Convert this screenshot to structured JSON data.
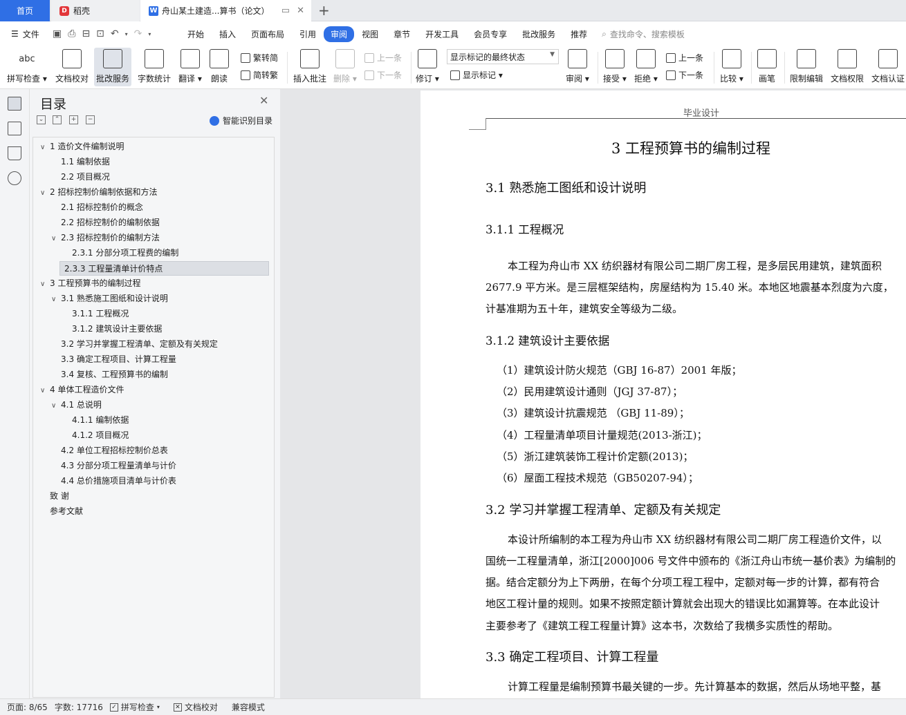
{
  "tabs": {
    "home": "首页",
    "daoke": "稻壳",
    "daoke_logo": "D",
    "doc": "舟山某土建造...算书（论文）",
    "doc_logo": "W"
  },
  "menubar": {
    "file": "文件",
    "items": [
      "开始",
      "插入",
      "页面布局",
      "引用",
      "审阅",
      "视图",
      "章节",
      "开发工具",
      "会员专享",
      "批改服务",
      "推荐"
    ],
    "active": "审阅",
    "search_placeholder": "查找命令、搜索模板"
  },
  "ribbon": {
    "spellcheck": "拼写检查",
    "spellcheck_icon": "abc",
    "doc_proof": "文档校对",
    "review_service": "批改服务",
    "word_count": "字数统计",
    "translate": "翻译",
    "read_aloud": "朗读",
    "trad_to_simp": "繁转简",
    "simp_to_trad": "简转繁",
    "insert_comment": "插入批注",
    "delete": "删除",
    "prev_comment": "上一条",
    "next_comment": "下一条",
    "track_changes": "修订",
    "markup_select": "显示标记的最终状态",
    "show_markup": "显示标记",
    "review": "审阅",
    "accept": "接受",
    "reject": "拒绝",
    "prev_change": "上一条",
    "next_change": "下一条",
    "compare": "比较",
    "pen": "画笔",
    "restrict_edit": "限制编辑",
    "doc_permission": "文档权限",
    "doc_certify": "文档认证"
  },
  "outline": {
    "title": "目录",
    "smart_toc": "智能识别目录",
    "items": [
      {
        "text": "1 造价文件编制说明",
        "level": 1,
        "twisty": "v"
      },
      {
        "text": "1.1 编制依据",
        "level": 2,
        "twisty": ""
      },
      {
        "text": "2.2  项目概况",
        "level": 2,
        "twisty": ""
      },
      {
        "text": "2 招标控制价编制依据和方法",
        "level": 1,
        "twisty": "v"
      },
      {
        "text": "2.1 招标控制价的概念",
        "level": 2,
        "twisty": ""
      },
      {
        "text": "2.2 招标控制价的编制依据",
        "level": 2,
        "twisty": ""
      },
      {
        "text": "2.3 招标控制价的编制方法",
        "level": 2,
        "twisty": "v"
      },
      {
        "text": "2.3.1 分部分项工程费的编制",
        "level": 3,
        "twisty": ""
      },
      {
        "text": "2.3.3 工程量清单计价特点",
        "level": 3,
        "twisty": "",
        "selected": true
      },
      {
        "text": "3 工程预算书的编制过程",
        "level": 1,
        "twisty": "v"
      },
      {
        "text": "3.1 熟悉施工图纸和设计说明",
        "level": 2,
        "twisty": "v"
      },
      {
        "text": "3.1.1 工程概况",
        "level": 3,
        "twisty": ""
      },
      {
        "text": "3.1.2 建筑设计主要依据",
        "level": 3,
        "twisty": ""
      },
      {
        "text": "3.2 学习并掌握工程清单、定额及有关规定",
        "level": 2,
        "twisty": ""
      },
      {
        "text": "3.3 确定工程项目、计算工程量",
        "level": 2,
        "twisty": ""
      },
      {
        "text": "3.4 复核、工程预算书的编制",
        "level": 2,
        "twisty": ""
      },
      {
        "text": "4 单体工程造价文件",
        "level": 1,
        "twisty": "v"
      },
      {
        "text": "4.1 总说明",
        "level": 2,
        "twisty": "v"
      },
      {
        "text": "4.1.1 编制依据",
        "level": 3,
        "twisty": ""
      },
      {
        "text": "4.1.2 项目概况",
        "level": 3,
        "twisty": ""
      },
      {
        "text": "4.2 单位工程招标控制价总表",
        "level": 2,
        "twisty": ""
      },
      {
        "text": "4.3 分部分项工程量清单与计价",
        "level": 2,
        "twisty": ""
      },
      {
        "text": "4.4 总价措施项目清单与计价表",
        "level": 2,
        "twisty": ""
      },
      {
        "text": "致    谢",
        "level": 1,
        "twisty": ""
      },
      {
        "text": "参考文献",
        "level": 1,
        "twisty": ""
      }
    ]
  },
  "document": {
    "header": "毕业设计",
    "chapter_title": "3 工程预算书的编制过程",
    "s31": "3.1 熟悉施工图纸和设计说明",
    "s311": "3.1.1 工程概况",
    "p1_l1": "本工程为舟山市 XX 纺织器材有限公司二期厂房工程，是多层民用建筑，建筑面积",
    "p1_l2": "2677.9 平方米。是三层框架结构，房屋结构为 15.40 米。本地区地震基本烈度为六度，",
    "p1_l3": "计基准期为五十年，建筑安全等级为二级。",
    "s312": "3.1.2 建筑设计主要依据",
    "basis": [
      "（1）建筑设计防火规范（GBJ 16-87）2001 年版；",
      "（2）民用建筑设计通则（JGJ    37-87）；",
      "（3）建筑设计抗震规范 （GBJ    11-89）；",
      "（4）工程量清单项目计量规范(2013-浙江)；",
      "（5）浙江建筑装饰工程计价定额(2013)；",
      "（6）屋面工程技术规范（GB50207-94）；"
    ],
    "s32": "3.2 学习并掌握工程清单、定额及有关规定",
    "p2_l1": "本设计所编制的本工程为舟山市 XX 纺织器材有限公司二期厂房工程造价文件，以",
    "p2_l2": "国统一工程量清单，浙江[2000]006 号文件中颁布的《浙江舟山市统一基价表》为编制的",
    "p2_l3": "据。结合定额分为上下两册，在每个分项工程工程中，定额对每一步的计算，都有符合",
    "p2_l4": "地区工程计量的规则。如果不按照定额计算就会出现大的错误比如漏算等。在本此设计",
    "p2_l5": "主要参考了《建筑工程工程量计算》这本书，次数给了我横多实质性的帮助。",
    "s33": "3.3 确定工程项目、计算工程量",
    "p3_l1": "计算工程量是编制预算书最关键的一步。先计算基本的数据，然后从场地平整，基"
  },
  "status": {
    "page": "页面: 8/65",
    "words": "字数: 17716",
    "spellcheck": "拼写检查",
    "proof": "文档校对",
    "compat": "兼容模式"
  }
}
